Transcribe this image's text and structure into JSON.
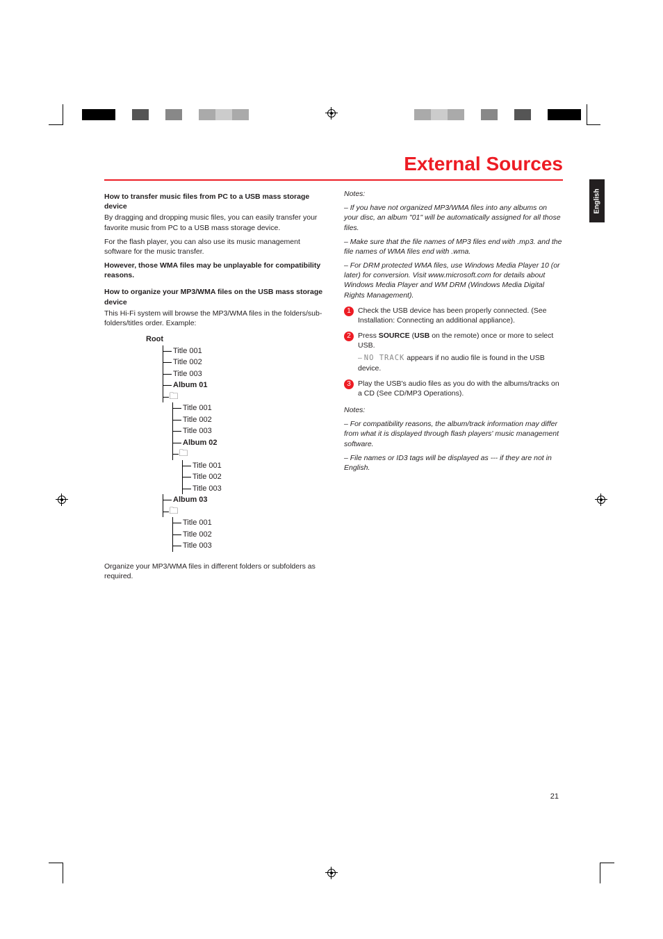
{
  "header": {
    "title": "External Sources",
    "language_tab": "English",
    "page_number": "21"
  },
  "left_col": {
    "h1": "How to transfer music files from PC to a USB mass storage device",
    "p1": "By dragging and dropping music files, you can easily transfer your favorite music from PC to a USB mass storage device.",
    "p2": "For the flash player, you can also use its music management software for the music transfer.",
    "p3_bold": "However, those WMA files may be unplayable for compatibility reasons.",
    "h2": "How to organize your MP3/WMA files on the USB mass storage device",
    "p4": "This Hi-Fi system will browse the MP3/WMA files in the folders/sub-folders/titles order. Example:",
    "tree": {
      "root": "Root",
      "root_titles": [
        "Title 001",
        "Title 002",
        "Title 003"
      ],
      "albums": [
        {
          "name": "Album 01",
          "titles": [
            "Title 001",
            "Title 002",
            "Title 003"
          ]
        },
        {
          "name": "Album 02",
          "titles": [
            "Title 001",
            "Title 002",
            "Title 003"
          ]
        },
        {
          "name": "Album 03",
          "titles": [
            "Title 001",
            "Title 002",
            "Title 003"
          ]
        }
      ]
    },
    "p5": "Organize your MP3/WMA files in different folders or subfolders as required."
  },
  "right_col": {
    "notes1_label": "Notes:",
    "notes1_items": [
      "If you have not organized MP3/WMA files into any albums on your disc, an album \"01\" will be automatically assigned for all those files.",
      "Make sure that the file names of MP3 files end with .mp3. and the file names of WMA files end with .wma.",
      "For DRM protected WMA files, use Windows Media Player 10 (or later) for conversion. Visit www.microsoft.com for details about Windows Media Player and WM DRM (Windows Media Digital Rights Management)."
    ],
    "steps": [
      {
        "n": "1",
        "text": "Check the USB device has been properly connected. (See Installation: Connecting an additional appliance)."
      },
      {
        "n": "2",
        "text_pre": "Press ",
        "text_b1": "SOURCE",
        "text_mid1": " (",
        "text_b2": "USB",
        "text_mid2": " on the remote) once or more to select USB.",
        "sub_dash": "– ",
        "sub_seg": "NO TRACK",
        "sub_after": " appears if no audio file is found in the USB device."
      },
      {
        "n": "3",
        "text": "Play the USB's audio files as you do with the albums/tracks on a CD (See CD/MP3 Operations)."
      }
    ],
    "notes2_label": "Notes:",
    "notes2_items": [
      "For compatibility reasons, the album/track information may differ from what it is displayed through flash players' music management software.",
      "File names or ID3 tags will be displayed as --- if they are not in English."
    ]
  }
}
